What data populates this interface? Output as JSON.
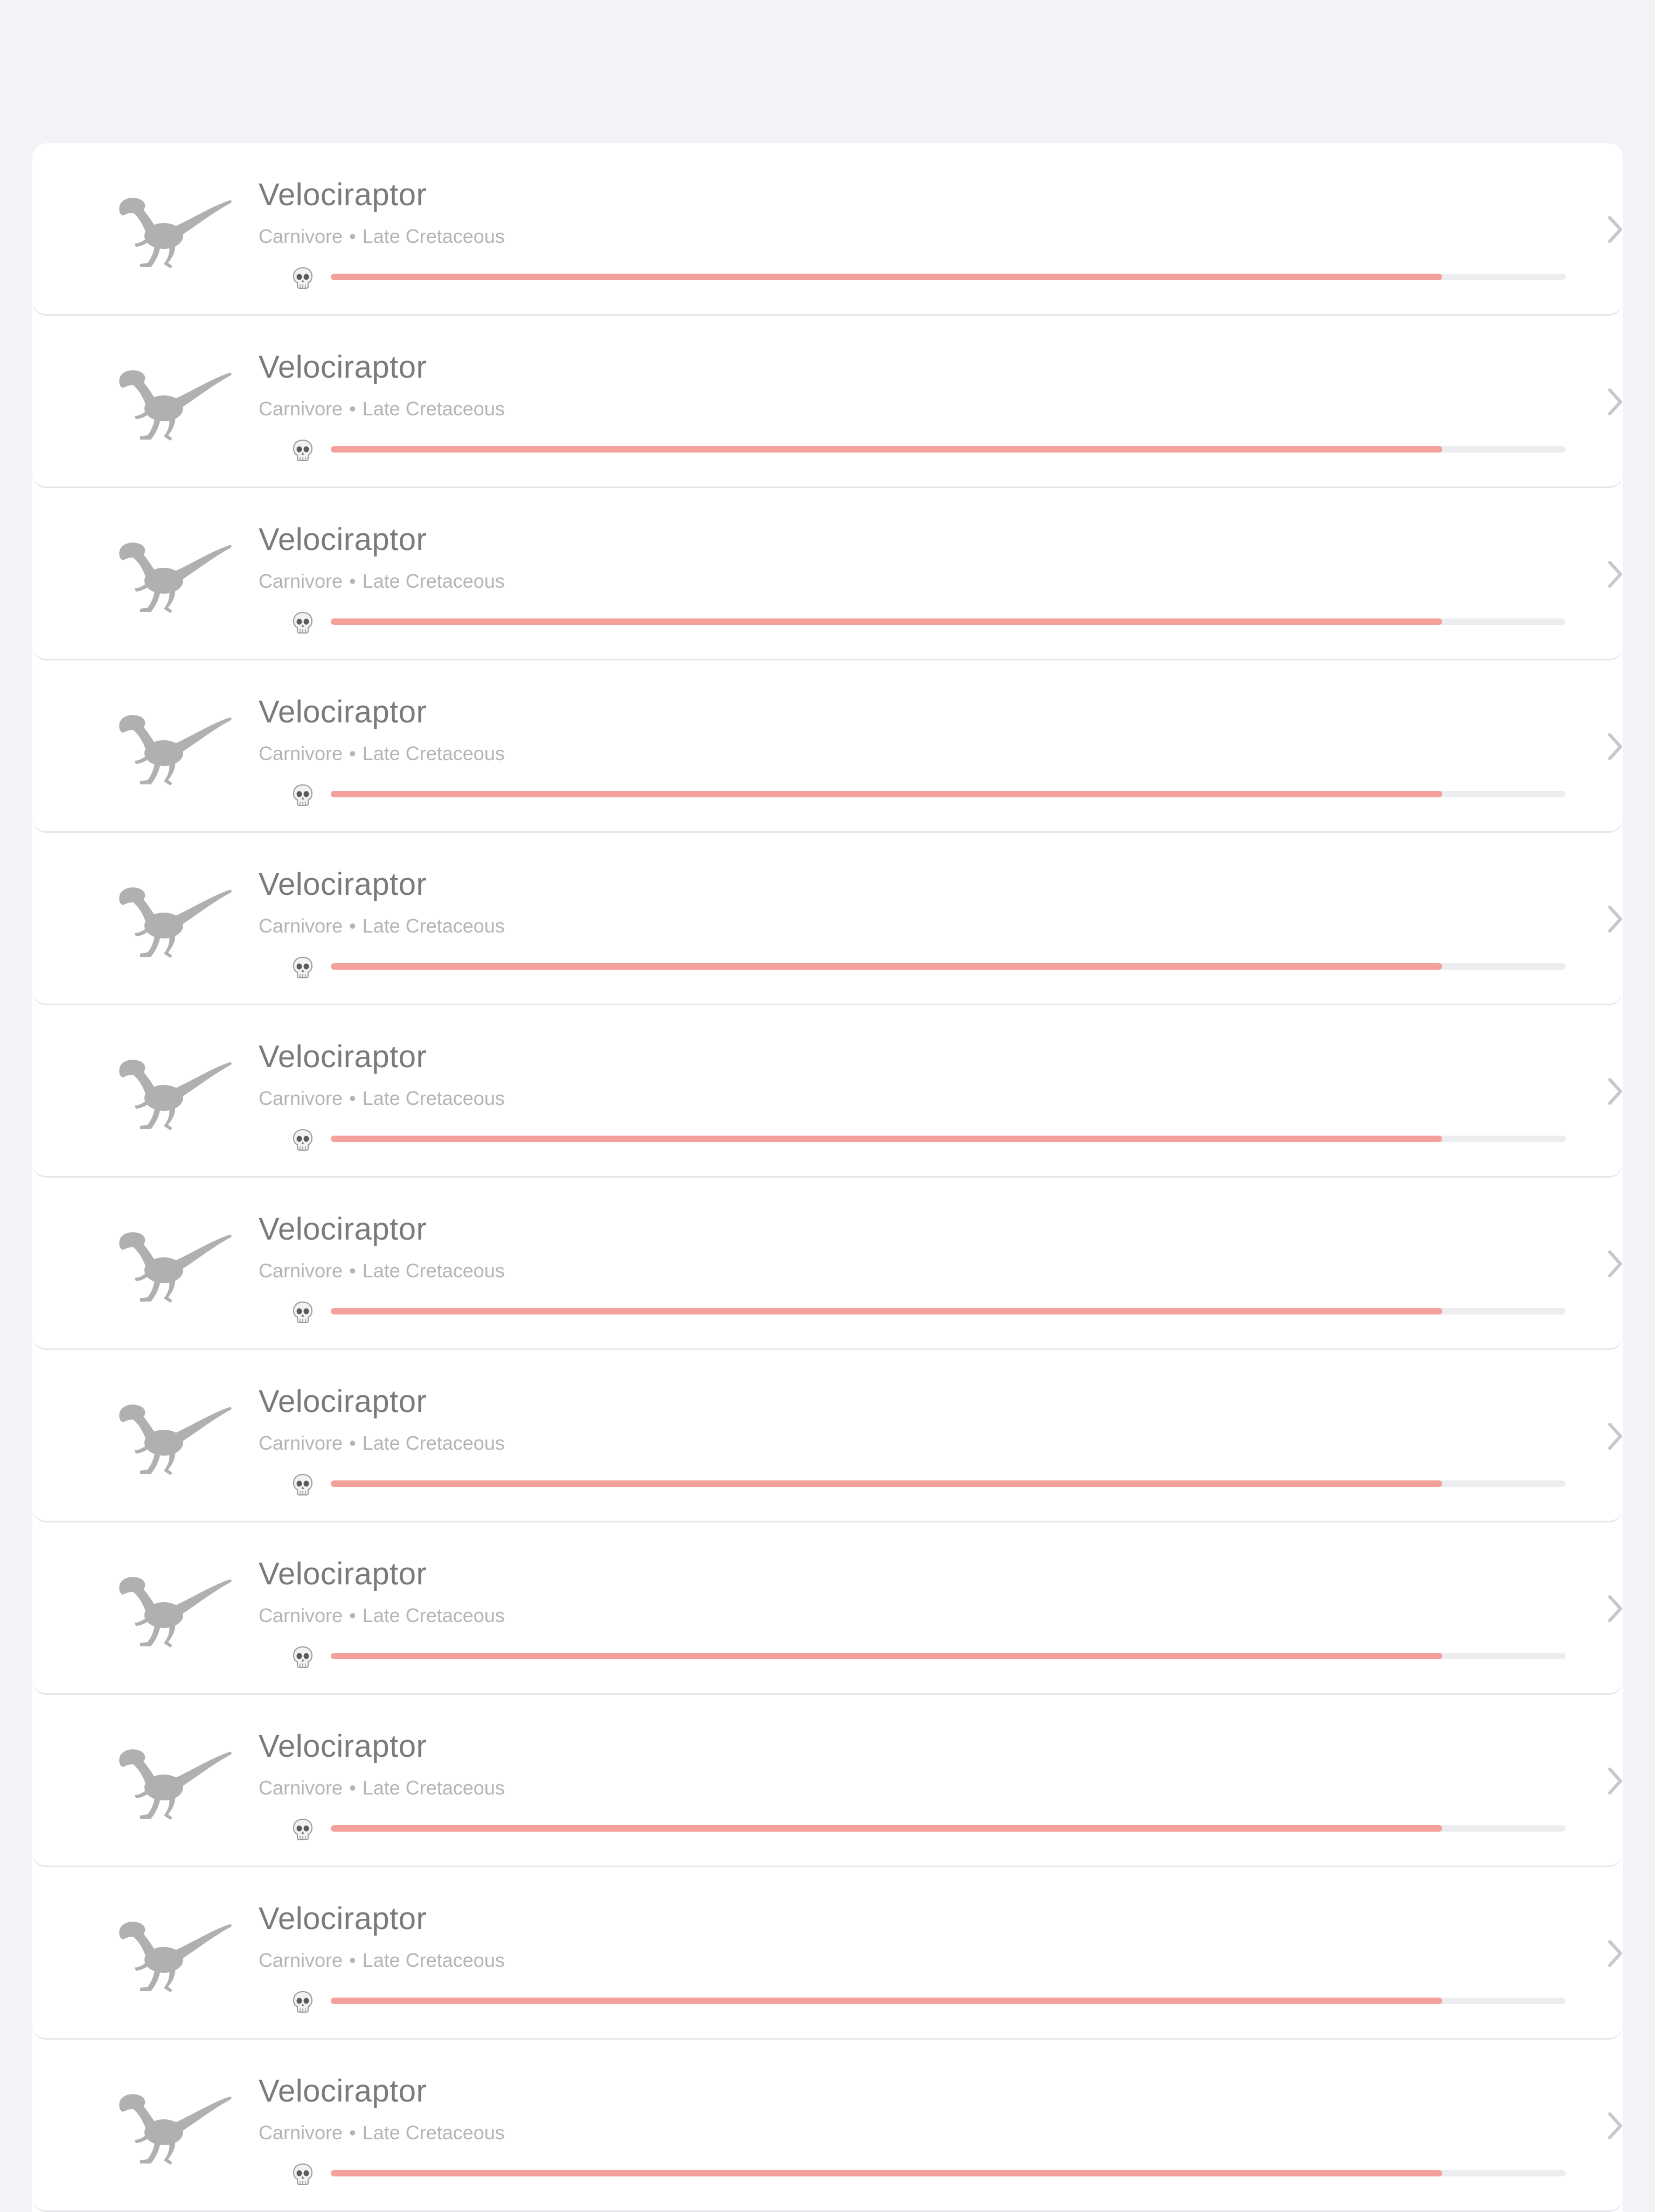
{
  "colors": {
    "background": "#f2f2f7",
    "card": "#ffffff",
    "title": "#7a7a7a",
    "subtitle": "#b4b4b4",
    "bar_fill": "#f4a09b",
    "bar_track": "#ededef",
    "icon": "#b0b0b0"
  },
  "dinosaurs": [
    {
      "name": "Velociraptor",
      "diet": "Carnivore",
      "separator": "•",
      "period": "Late Cretaceous",
      "icon": "velociraptor-silhouette-icon",
      "danger_icon": "skull-icon",
      "danger_level": 0.9
    },
    {
      "name": "Velociraptor",
      "diet": "Carnivore",
      "separator": "•",
      "period": "Late Cretaceous",
      "icon": "velociraptor-silhouette-icon",
      "danger_icon": "skull-icon",
      "danger_level": 0.9
    },
    {
      "name": "Velociraptor",
      "diet": "Carnivore",
      "separator": "•",
      "period": "Late Cretaceous",
      "icon": "velociraptor-silhouette-icon",
      "danger_icon": "skull-icon",
      "danger_level": 0.9
    },
    {
      "name": "Velociraptor",
      "diet": "Carnivore",
      "separator": "•",
      "period": "Late Cretaceous",
      "icon": "velociraptor-silhouette-icon",
      "danger_icon": "skull-icon",
      "danger_level": 0.9
    },
    {
      "name": "Velociraptor",
      "diet": "Carnivore",
      "separator": "•",
      "period": "Late Cretaceous",
      "icon": "velociraptor-silhouette-icon",
      "danger_icon": "skull-icon",
      "danger_level": 0.9
    },
    {
      "name": "Velociraptor",
      "diet": "Carnivore",
      "separator": "•",
      "period": "Late Cretaceous",
      "icon": "velociraptor-silhouette-icon",
      "danger_icon": "skull-icon",
      "danger_level": 0.9
    },
    {
      "name": "Velociraptor",
      "diet": "Carnivore",
      "separator": "•",
      "period": "Late Cretaceous",
      "icon": "velociraptor-silhouette-icon",
      "danger_icon": "skull-icon",
      "danger_level": 0.9
    },
    {
      "name": "Velociraptor",
      "diet": "Carnivore",
      "separator": "•",
      "period": "Late Cretaceous",
      "icon": "velociraptor-silhouette-icon",
      "danger_icon": "skull-icon",
      "danger_level": 0.9
    },
    {
      "name": "Velociraptor",
      "diet": "Carnivore",
      "separator": "•",
      "period": "Late Cretaceous",
      "icon": "velociraptor-silhouette-icon",
      "danger_icon": "skull-icon",
      "danger_level": 0.9
    },
    {
      "name": "Velociraptor",
      "diet": "Carnivore",
      "separator": "•",
      "period": "Late Cretaceous",
      "icon": "velociraptor-silhouette-icon",
      "danger_icon": "skull-icon",
      "danger_level": 0.9
    },
    {
      "name": "Velociraptor",
      "diet": "Carnivore",
      "separator": "•",
      "period": "Late Cretaceous",
      "icon": "velociraptor-silhouette-icon",
      "danger_icon": "skull-icon",
      "danger_level": 0.9
    },
    {
      "name": "Velociraptor",
      "diet": "Carnivore",
      "separator": "•",
      "period": "Late Cretaceous",
      "icon": "velociraptor-silhouette-icon",
      "danger_icon": "skull-icon",
      "danger_level": 0.9
    }
  ]
}
